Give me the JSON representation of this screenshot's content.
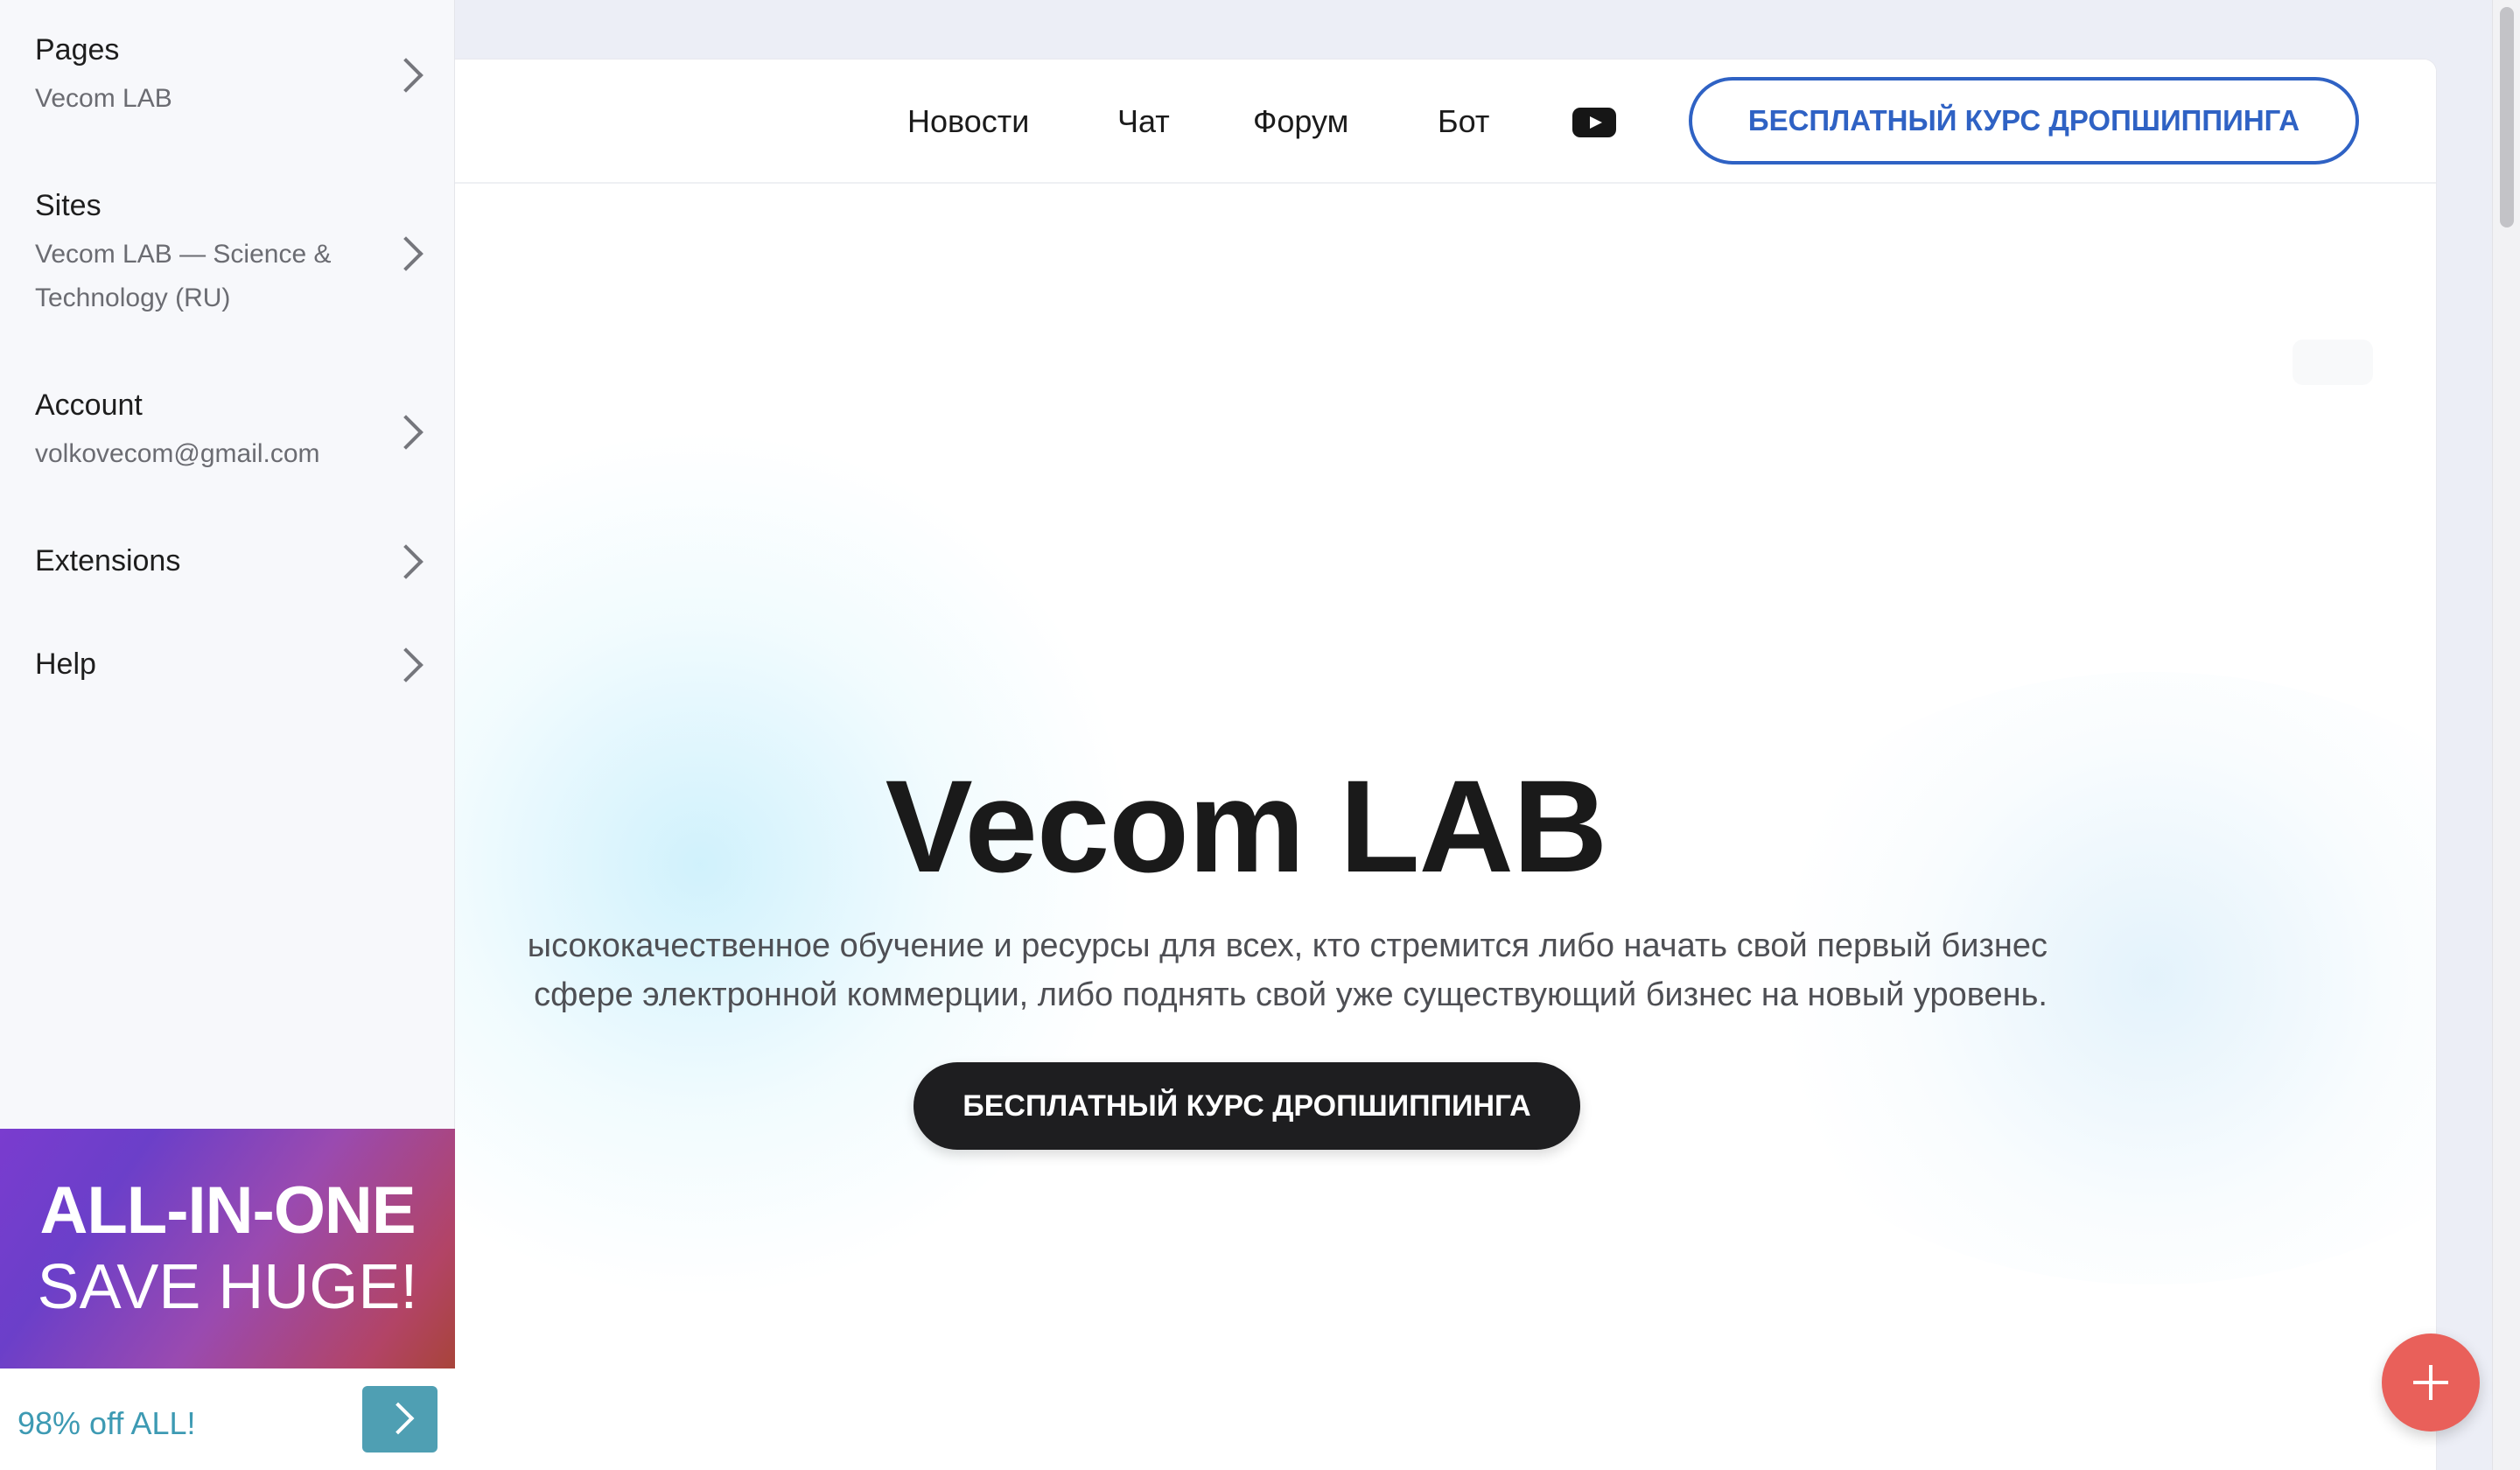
{
  "sidebar": {
    "items": [
      {
        "title": "Pages",
        "subtitle": "Vecom LAB"
      },
      {
        "title": "Sites",
        "subtitle_line1": "Vecom LAB — Science &",
        "subtitle_line2": "Technology (RU)"
      },
      {
        "title": "Account",
        "subtitle": "volkovecom@gmail.com"
      },
      {
        "title": "Extensions"
      },
      {
        "title": "Help"
      }
    ],
    "promo": {
      "line1": "ALL-IN-ONE",
      "line2": "SAVE HUGE!",
      "footer_text": "98% off ALL!"
    }
  },
  "site": {
    "nav": {
      "news": "Новости",
      "chat": "Чат",
      "forum": "Форум",
      "bot": "Бот",
      "youtube_icon": "youtube-icon",
      "cta": "БЕСПЛАТНЫЙ КУРС ДРОПШИППИНГА"
    },
    "hero": {
      "title": "Vecom LAB",
      "subtitle_line1": "ысококачественное обучение и ресурсы для всех, кто стремится либо начать свой первый бизнес",
      "subtitle_line2": "сфере электронной коммерции, либо поднять свой уже существующий бизнес на новый уровень.",
      "cta": "БЕСПЛАТНЫЙ КУРС ДРОПШИППИНГА"
    }
  },
  "colors": {
    "accent_blue": "#2f62c4",
    "promo_teal": "#4f9fb3",
    "fab_red": "#e9605a"
  }
}
